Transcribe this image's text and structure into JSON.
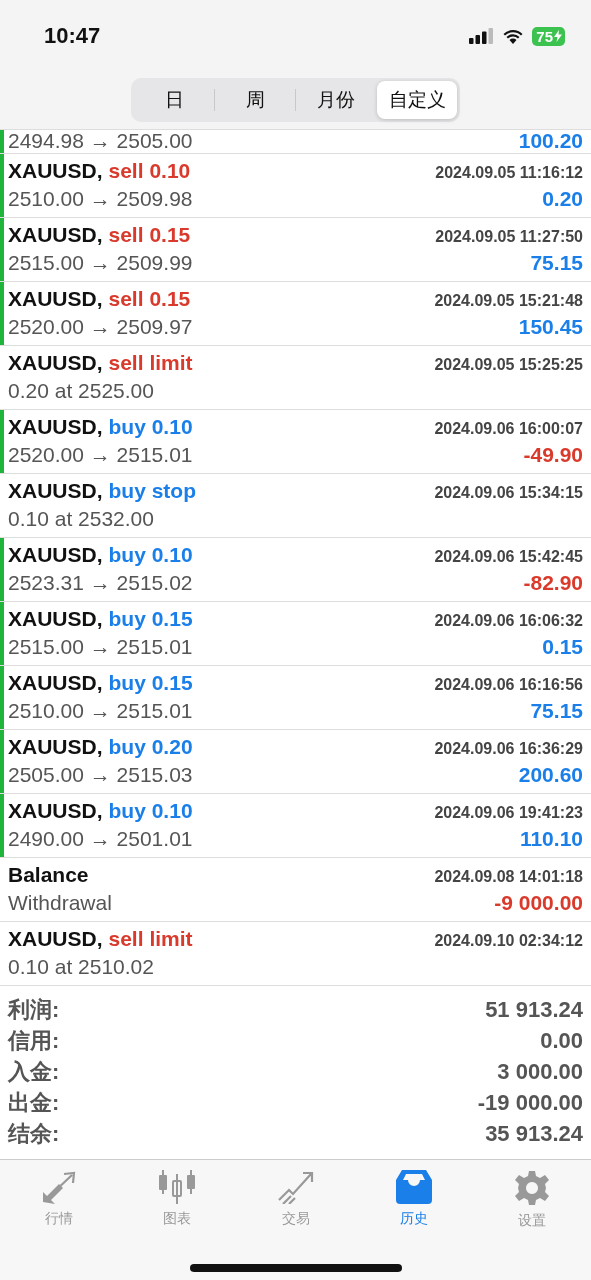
{
  "status_bar": {
    "time": "10:47",
    "battery": "75"
  },
  "period_tabs": [
    {
      "label": "日",
      "selected": false
    },
    {
      "label": "周",
      "selected": false
    },
    {
      "label": "月份",
      "selected": false
    },
    {
      "label": "自定义",
      "selected": true
    }
  ],
  "partial_row": {
    "kind": "deal",
    "prices": "2494.98 → 2505.00",
    "profit": "100.20",
    "loss": false
  },
  "rows": [
    {
      "kind": "deal",
      "symbol": "XAUUSD,",
      "color": "#d93a2b",
      "type": "sell 0.10",
      "time": "2024.09.05 11:16:12",
      "detail": "2510.00 → 2509.98",
      "profit": "0.20",
      "loss": false
    },
    {
      "kind": "deal",
      "symbol": "XAUUSD,",
      "color": "#d93a2b",
      "type": "sell 0.15",
      "time": "2024.09.05 11:27:50",
      "detail": "2515.00 → 2509.99",
      "profit": "75.15",
      "loss": false
    },
    {
      "kind": "deal",
      "symbol": "XAUUSD,",
      "color": "#d93a2b",
      "type": "sell 0.15",
      "time": "2024.09.05 15:21:48",
      "detail": "2520.00 → 2509.97",
      "profit": "150.45",
      "loss": false
    },
    {
      "kind": "order",
      "symbol": "XAUUSD,",
      "color": "#d93a2b",
      "type": "sell limit",
      "time": "2024.09.05 15:25:25",
      "detail": "0.20 at 2525.00"
    },
    {
      "kind": "deal",
      "symbol": "XAUUSD,",
      "color": "#1a7fe8",
      "type": "buy 0.10",
      "time": "2024.09.06 16:00:07",
      "detail": "2520.00 → 2515.01",
      "profit": "-49.90",
      "loss": true
    },
    {
      "kind": "order",
      "symbol": "XAUUSD,",
      "color": "#1a7fe8",
      "type": "buy stop",
      "time": "2024.09.06 15:34:15",
      "detail": "0.10 at 2532.00"
    },
    {
      "kind": "deal",
      "symbol": "XAUUSD,",
      "color": "#1a7fe8",
      "type": "buy 0.10",
      "time": "2024.09.06 15:42:45",
      "detail": "2523.31 → 2515.02",
      "profit": "-82.90",
      "loss": true
    },
    {
      "kind": "deal",
      "symbol": "XAUUSD,",
      "color": "#1a7fe8",
      "type": "buy 0.15",
      "time": "2024.09.06 16:06:32",
      "detail": "2515.00 → 2515.01",
      "profit": "0.15",
      "loss": false
    },
    {
      "kind": "deal",
      "symbol": "XAUUSD,",
      "color": "#1a7fe8",
      "type": "buy 0.15",
      "time": "2024.09.06 16:16:56",
      "detail": "2510.00 → 2515.01",
      "profit": "75.15",
      "loss": false
    },
    {
      "kind": "deal",
      "symbol": "XAUUSD,",
      "color": "#1a7fe8",
      "type": "buy 0.20",
      "time": "2024.09.06 16:36:29",
      "detail": "2505.00 → 2515.03",
      "profit": "200.60",
      "loss": false
    },
    {
      "kind": "deal",
      "symbol": "XAUUSD,",
      "color": "#1a7fe8",
      "type": "buy 0.10",
      "time": "2024.09.06 19:41:23",
      "detail": "2490.00 → 2501.01",
      "profit": "110.10",
      "loss": false
    },
    {
      "kind": "balance",
      "symbol": "Balance",
      "time": "2024.09.08 14:01:18",
      "detail": "Withdrawal",
      "profit": "-9 000.00",
      "loss": true
    },
    {
      "kind": "order",
      "symbol": "XAUUSD,",
      "color": "#d93a2b",
      "type": "sell limit",
      "time": "2024.09.10 02:34:12",
      "detail": "0.10 at 2510.02"
    }
  ],
  "summary": [
    {
      "label": "利润:",
      "value": "51 913.24"
    },
    {
      "label": "信用:",
      "value": "0.00"
    },
    {
      "label": "入金:",
      "value": "3 000.00"
    },
    {
      "label": "出金:",
      "value": "-19 000.00"
    },
    {
      "label": "结余:",
      "value": "35 913.24"
    }
  ],
  "tab_bar": [
    {
      "kind": "quotes",
      "label": "行情",
      "selected": false
    },
    {
      "kind": "chart",
      "label": "图表",
      "selected": false
    },
    {
      "kind": "trade",
      "label": "交易",
      "selected": false
    },
    {
      "kind": "history",
      "label": "历史",
      "selected": true
    },
    {
      "kind": "settings",
      "label": "设置",
      "selected": false
    }
  ]
}
